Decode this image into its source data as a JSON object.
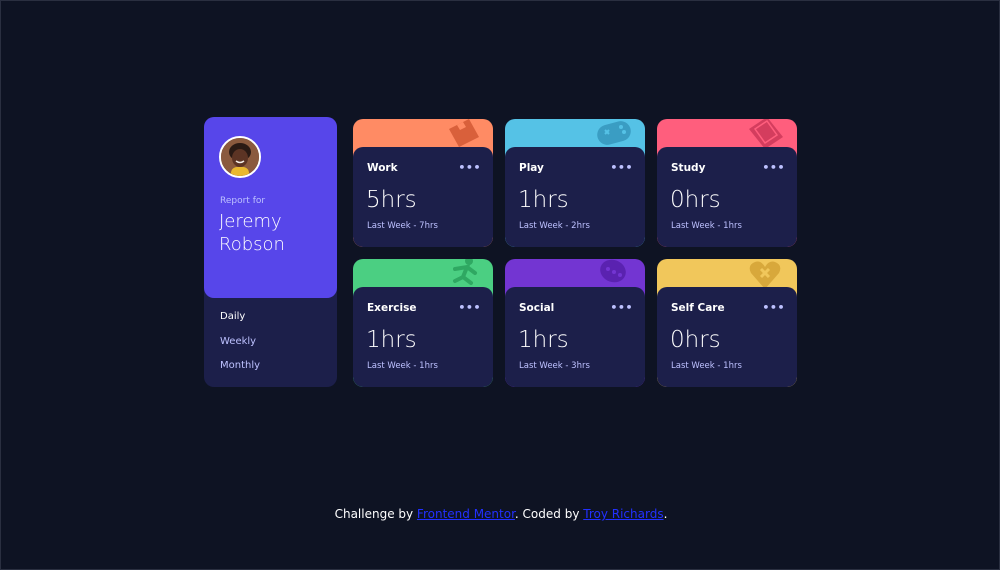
{
  "profile": {
    "report_for": "Report for",
    "name": "Jeremy Robson",
    "avatar_icon": "user-avatar-photo",
    "accent_color": "#5746ea",
    "timeframes": [
      "Daily",
      "Weekly",
      "Monthly"
    ],
    "active_timeframe": "Daily"
  },
  "activities": [
    {
      "title": "Work",
      "current": "5hrs",
      "previous": "Last Week - 7hrs",
      "color": "#ff8b64",
      "icon": "briefcase-icon",
      "menu": "•••"
    },
    {
      "title": "Play",
      "current": "1hrs",
      "previous": "Last Week - 2hrs",
      "color": "#55c2e6",
      "icon": "gamepad-icon",
      "menu": "•••"
    },
    {
      "title": "Study",
      "current": "0hrs",
      "previous": "Last Week - 1hrs",
      "color": "#ff5e7d",
      "icon": "book-icon",
      "menu": "•••"
    },
    {
      "title": "Exercise",
      "current": "1hrs",
      "previous": "Last Week - 1hrs",
      "color": "#4bcf82",
      "icon": "runner-icon",
      "menu": "•••"
    },
    {
      "title": "Social",
      "current": "1hrs",
      "previous": "Last Week - 3hrs",
      "color": "#7335d2",
      "icon": "social-icon",
      "menu": "•••"
    },
    {
      "title": "Self Care",
      "current": "0hrs",
      "previous": "Last Week - 1hrs",
      "color": "#f1c75b",
      "icon": "heart-care-icon",
      "menu": "•••"
    }
  ],
  "footer": {
    "prefix": "Challenge by ",
    "link1": "Frontend Mentor",
    "middle": ". Coded by ",
    "link2": "Troy Richards",
    "suffix": "."
  }
}
